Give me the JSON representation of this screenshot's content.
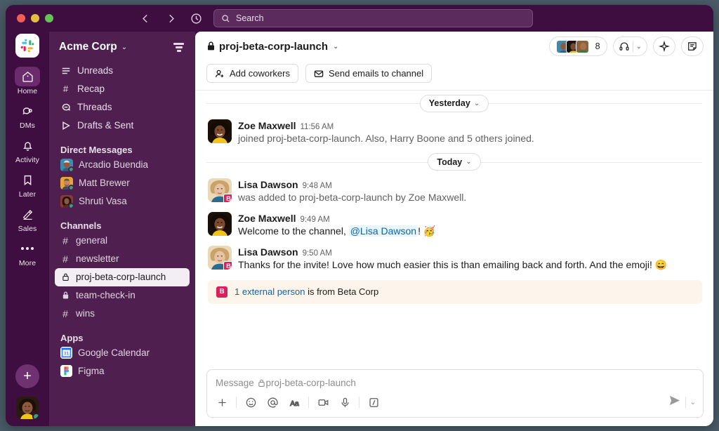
{
  "window": {
    "traffic_lights": [
      "close",
      "minimize",
      "maximize"
    ]
  },
  "topbar": {
    "back_icon": "arrow-left-icon",
    "forward_icon": "arrow-right-icon",
    "history_icon": "clock-icon",
    "search_placeholder": "Search"
  },
  "rail": {
    "logo": "slack-logo",
    "items": [
      {
        "label": "Home",
        "icon": "home-icon",
        "active": true
      },
      {
        "label": "DMs",
        "icon": "dm-icon",
        "active": false
      },
      {
        "label": "Activity",
        "icon": "bell-icon",
        "active": false
      },
      {
        "label": "Later",
        "icon": "bookmark-icon",
        "active": false
      },
      {
        "label": "Sales",
        "icon": "sales-icon",
        "active": false
      },
      {
        "label": "More",
        "icon": "ellipsis-icon",
        "active": false
      }
    ],
    "new_label": "+",
    "avatar": "user-avatar"
  },
  "sidebar": {
    "workspace": "Acme Corp",
    "workspace_chevron": "⌄",
    "filter_icon": "filter-icon",
    "nav": [
      {
        "label": "Unreads",
        "icon": "unreads-icon"
      },
      {
        "label": "Recap",
        "icon": "hash-icon"
      },
      {
        "label": "Threads",
        "icon": "threads-icon"
      },
      {
        "label": "Drafts & Sent",
        "icon": "send-outline-icon"
      }
    ],
    "sections": [
      {
        "title": "Direct Messages",
        "items": [
          {
            "label": "Arcadio Buendia",
            "kind": "dm",
            "presence": "active"
          },
          {
            "label": "Matt Brewer",
            "kind": "dm",
            "presence": "active"
          },
          {
            "label": "Shruti Vasa",
            "kind": "dm",
            "presence": "active"
          }
        ]
      },
      {
        "title": "Channels",
        "items": [
          {
            "label": "general",
            "kind": "public",
            "selected": false
          },
          {
            "label": "newsletter",
            "kind": "public",
            "selected": false
          },
          {
            "label": "proj-beta-corp-launch",
            "kind": "private",
            "selected": true
          },
          {
            "label": "team-check-in",
            "kind": "private",
            "selected": false
          },
          {
            "label": "wins",
            "kind": "public",
            "selected": false
          }
        ]
      },
      {
        "title": "Apps",
        "items": [
          {
            "label": "Google Calendar",
            "kind": "app",
            "app": "google-calendar"
          },
          {
            "label": "Figma",
            "kind": "app",
            "app": "figma"
          }
        ]
      }
    ]
  },
  "channel": {
    "name": "proj-beta-corp-launch",
    "privacy_icon": "lock-icon",
    "chevron": "⌄",
    "member_count": "8",
    "huddle_icon": "headphones-icon",
    "huddle_chevron": "⌄",
    "ai_icon": "sparkle-icon",
    "notes_icon": "notes-icon",
    "actions": [
      {
        "label": "Add coworkers",
        "icon": "add-person-icon"
      },
      {
        "label": "Send emails to channel",
        "icon": "envelope-icon"
      }
    ]
  },
  "messages": [
    {
      "type": "divider",
      "label": "Yesterday",
      "chevron": "⌄"
    },
    {
      "type": "message",
      "author": "Zoe Maxwell",
      "time": "11:56 AM",
      "text": "joined proj-beta-corp-launch. Also, Harry Boone and 5 others joined.",
      "system": true,
      "avatar": "zoe",
      "external": false
    },
    {
      "type": "divider",
      "label": "Today",
      "chevron": "⌄"
    },
    {
      "type": "message",
      "author": "Lisa Dawson",
      "time": "9:48 AM",
      "text": "was added to proj-beta-corp-launch by Zoe Maxwell.",
      "system": true,
      "avatar": "lisa",
      "external": true,
      "external_badge": "B"
    },
    {
      "type": "message",
      "author": "Zoe Maxwell",
      "time": "9:49 AM",
      "text_before": "Welcome to the channel, ",
      "mention": "@Lisa Dawson",
      "text_after": "! 🥳",
      "system": false,
      "avatar": "zoe",
      "external": false
    },
    {
      "type": "message",
      "author": "Lisa Dawson",
      "time": "9:50 AM",
      "text": "Thanks for the invite! Love how much easier this is than emailing back and forth. And the emoji! 😄",
      "system": false,
      "avatar": "lisa",
      "external": true,
      "external_badge": "B"
    }
  ],
  "banner": {
    "badge": "B",
    "link": "1 external person",
    "rest": " is from Beta Corp"
  },
  "composer": {
    "placeholder_prefix": "Message ",
    "lock_icon": "lock-icon",
    "placeholder_channel": "proj-beta-corp-launch",
    "tools": [
      {
        "name": "plus-icon"
      },
      {
        "name": "emoji-icon"
      },
      {
        "name": "mention-icon"
      },
      {
        "name": "format-text-icon"
      },
      {
        "name": "video-icon"
      },
      {
        "name": "microphone-icon"
      },
      {
        "name": "slash-command-icon"
      }
    ],
    "send_icon": "send-icon",
    "send_chevron": "⌄"
  },
  "colors": {
    "sidebar_bg": "#4F204F",
    "rail_bg": "#3F0E40",
    "accent_pink": "#E01E5A",
    "link_blue": "#1264A3",
    "banner_bg": "#FDF4EC",
    "presence_green": "#2BAC76"
  }
}
